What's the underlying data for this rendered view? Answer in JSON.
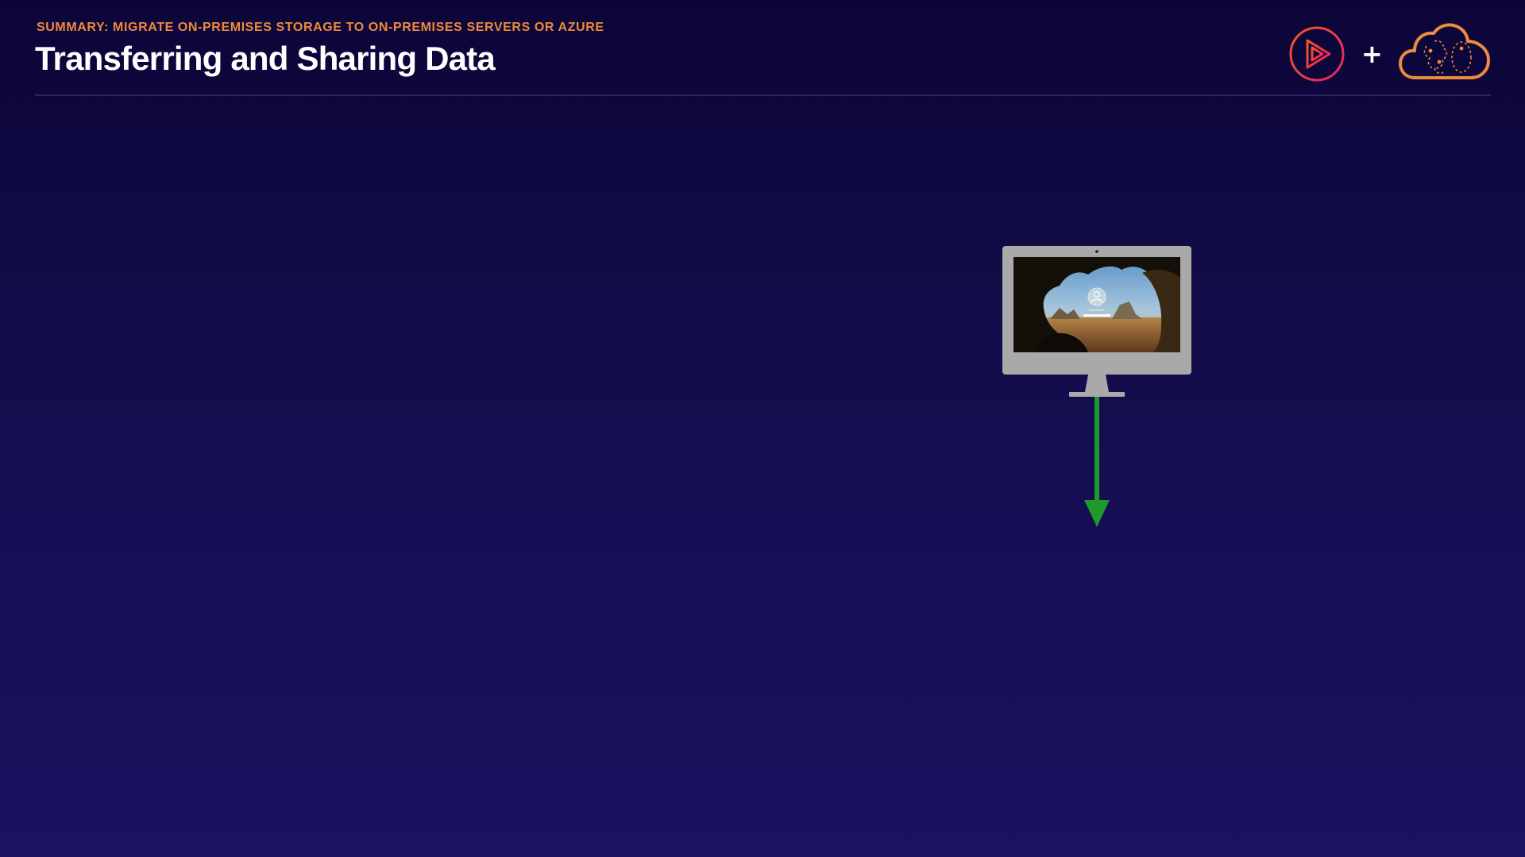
{
  "header": {
    "kicker": "SUMMARY: MIGRATE ON-PREMISES STORAGE TO ON-PREMISES SERVERS OR AZURE",
    "title": "Transferring and Sharing Data",
    "plus": "+"
  },
  "icons": {
    "brand_logo": "play-logo-icon",
    "cloud_logo": "cloud-brain-icon",
    "computer": "desktop-computer-icon",
    "arrow": "down-arrow-icon"
  },
  "colors": {
    "accent_orange": "#f08a3c",
    "brand_gradient_start": "#f05a28",
    "brand_gradient_end": "#e91e63",
    "arrow_green": "#1f9a2a",
    "monitor_grey": "#a9a9a9"
  }
}
